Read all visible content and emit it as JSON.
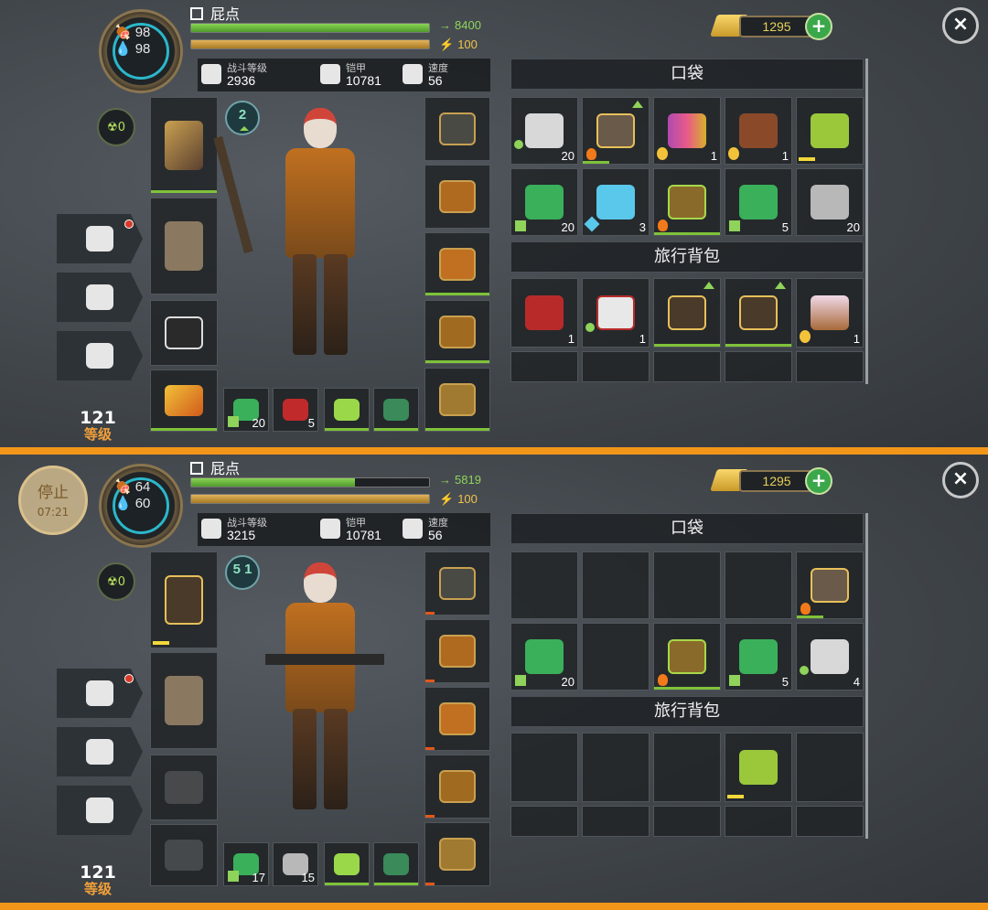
{
  "top": {
    "player_name": "屁点",
    "hunger": "98",
    "thirst": "98",
    "hp_value": "8400",
    "hp_fill": 1.0,
    "energy_value": "100",
    "energy_fill": 1.0,
    "radiation": "0",
    "level": "121",
    "level_label": "等级",
    "stats": {
      "combat_label": "战斗等级",
      "combat_value": "2936",
      "armor_label": "铠甲",
      "armor_value": "10781",
      "speed_label": "速度",
      "speed_value": "56"
    },
    "badge": "2",
    "gold": "1295",
    "pocket_label": "口袋",
    "backpack_label": "旅行背包",
    "pocket_counts": [
      "20",
      "",
      "1",
      "1",
      "",
      "20",
      "3",
      "",
      "5",
      "20"
    ],
    "backpack_counts": [
      "1",
      "1",
      "",
      "",
      "1"
    ],
    "quick_counts": [
      "20",
      "5",
      "",
      ""
    ]
  },
  "bottom": {
    "pause_label": "停止",
    "pause_time": "07:21",
    "player_name": "屁点",
    "hunger": "64",
    "thirst": "60",
    "hp_value": "5819",
    "hp_fill": 0.69,
    "energy_value": "100",
    "energy_fill": 1.0,
    "radiation": "0",
    "level": "121",
    "level_label": "等级",
    "stats": {
      "combat_label": "战斗等级",
      "combat_value": "3215",
      "armor_label": "铠甲",
      "armor_value": "10781",
      "speed_label": "速度",
      "speed_value": "56"
    },
    "badge": "5 1",
    "gold": "1295",
    "pocket_label": "口袋",
    "backpack_label": "旅行背包",
    "pocket_counts": [
      "",
      "",
      "",
      "",
      "",
      "20",
      "",
      "",
      "5",
      "4"
    ],
    "quick_counts": [
      "17",
      "15",
      "",
      ""
    ]
  },
  "icons": {
    "close": "×",
    "add": "+",
    "radiation": "☢"
  }
}
